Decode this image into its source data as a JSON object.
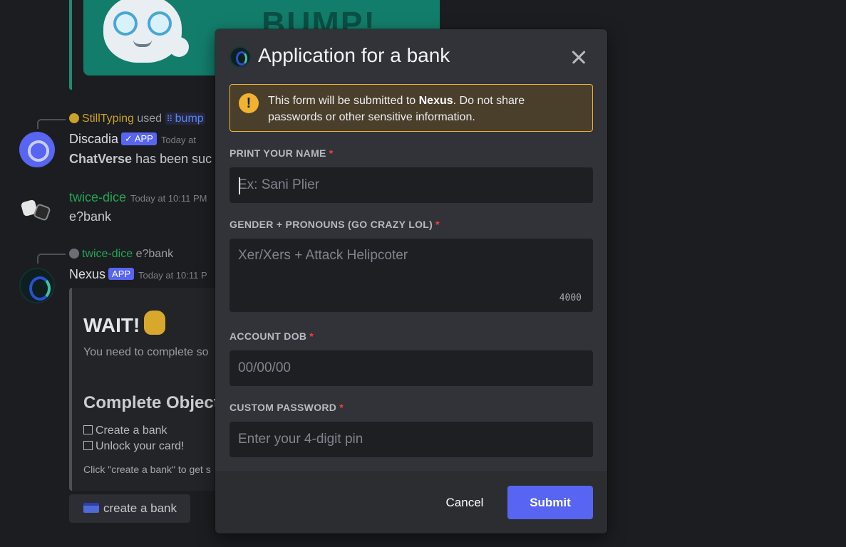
{
  "background": {
    "bump_banner_text": "BUMP!",
    "reply1": {
      "user": "StillTyping",
      "verb": "used",
      "command": "bump"
    },
    "discadia": {
      "name": "Discadia",
      "badge": "✓ APP",
      "timestamp": "Today at",
      "text_bold": "ChatVerse",
      "text_rest": " has been suc"
    },
    "twice_dice": {
      "name": "twice-dice",
      "timestamp": "Today at 10:11 PM",
      "text": "e?bank"
    },
    "reply2": {
      "user": "twice-dice",
      "command": "e?bank"
    },
    "nexus": {
      "name": "Nexus",
      "badge": "APP",
      "timestamp": "Today at 10:11 P"
    },
    "embed": {
      "title": "WAIT!",
      "subtitle": "You need to complete so",
      "objectives_title": "Complete Object",
      "objectives": [
        "Create a bank",
        "Unlock your card!"
      ],
      "hint": "Click \"create a bank\" to get s"
    },
    "create_bank_button": "create a bank"
  },
  "modal": {
    "title": "Application for a bank",
    "warning": {
      "prefix": "This form will be submitted to ",
      "app_name": "Nexus",
      "suffix": ". Do not share passwords or other sensitive information."
    },
    "fields": [
      {
        "label": "PRINT YOUR NAME",
        "required": "*",
        "placeholder": "Ex: Sani Plier",
        "value": ""
      },
      {
        "label": "GENDER + PRONOUNS (GO CRAZY LOL)",
        "required": "*",
        "placeholder": "Xer/Xers + Attack Helipcoter",
        "value": "",
        "char_limit": "4000"
      },
      {
        "label": "ACCOUNT DOB",
        "required": "*",
        "placeholder": "00/00/00",
        "value": ""
      },
      {
        "label": "CUSTOM PASSWORD",
        "required": "*",
        "placeholder": "Enter your 4-digit pin",
        "value": ""
      }
    ],
    "cancel_label": "Cancel",
    "submit_label": "Submit"
  },
  "colors": {
    "accent": "#5865f2",
    "warning": "#f0b232",
    "required": "#f23f43",
    "username_green": "#23a559",
    "username_gold": "#c9a227"
  }
}
